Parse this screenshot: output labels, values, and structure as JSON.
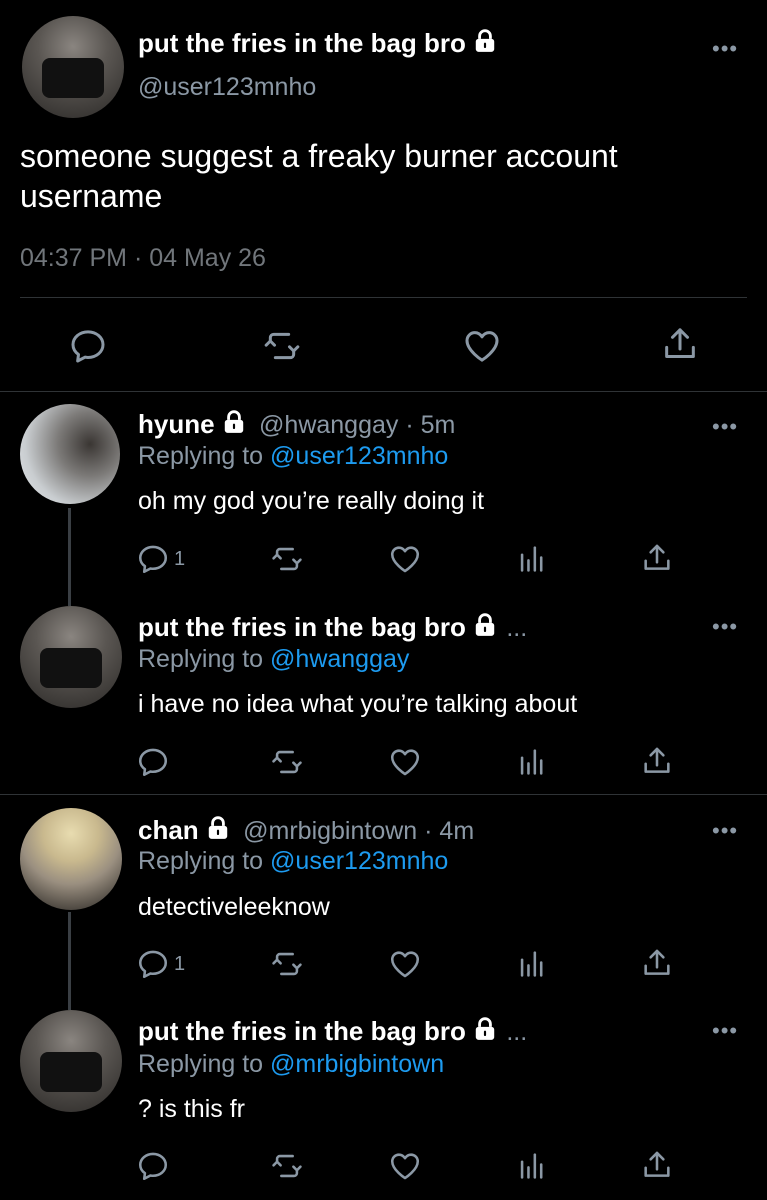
{
  "main_tweet": {
    "display_name": "put the fries in the bag bro",
    "handle": "@user123mnho",
    "text_line1": "someone suggest a freaky burner account",
    "text_line2": "username",
    "timestamp": "04:37 PM · 04 May 26"
  },
  "replies": [
    {
      "display_name": "hyune",
      "handle_time": "@hwanggay · 5m",
      "replying_label": "Replying to",
      "replying_to": "@user123mnho",
      "text": "oh my god you’re really doing it",
      "reply_count": "1"
    },
    {
      "display_name": "put the fries in the bag bro",
      "handle_time": "...",
      "replying_label": "Replying to",
      "replying_to": "@hwanggay",
      "text": "i have no idea what you’re talking about",
      "reply_count": ""
    },
    {
      "display_name": "chan",
      "handle_time": "@mrbigbintown · 4m",
      "replying_label": "Replying to",
      "replying_to": "@user123mnho",
      "text": "detectiveleeknow",
      "reply_count": "1"
    },
    {
      "display_name": "put the fries in the bag bro",
      "handle_time": "...",
      "replying_label": "Replying to",
      "replying_to": "@mrbigbintown",
      "text": "? is this fr",
      "reply_count": ""
    }
  ],
  "more_label": "•••",
  "colors": {
    "background": "#000000",
    "link": "#1d9bf0",
    "muted": "#8b98a5",
    "divider": "#2f3336"
  },
  "icons": [
    "reply-icon",
    "retweet-icon",
    "like-icon",
    "analytics-icon",
    "share-icon",
    "lock-icon",
    "more-icon"
  ]
}
